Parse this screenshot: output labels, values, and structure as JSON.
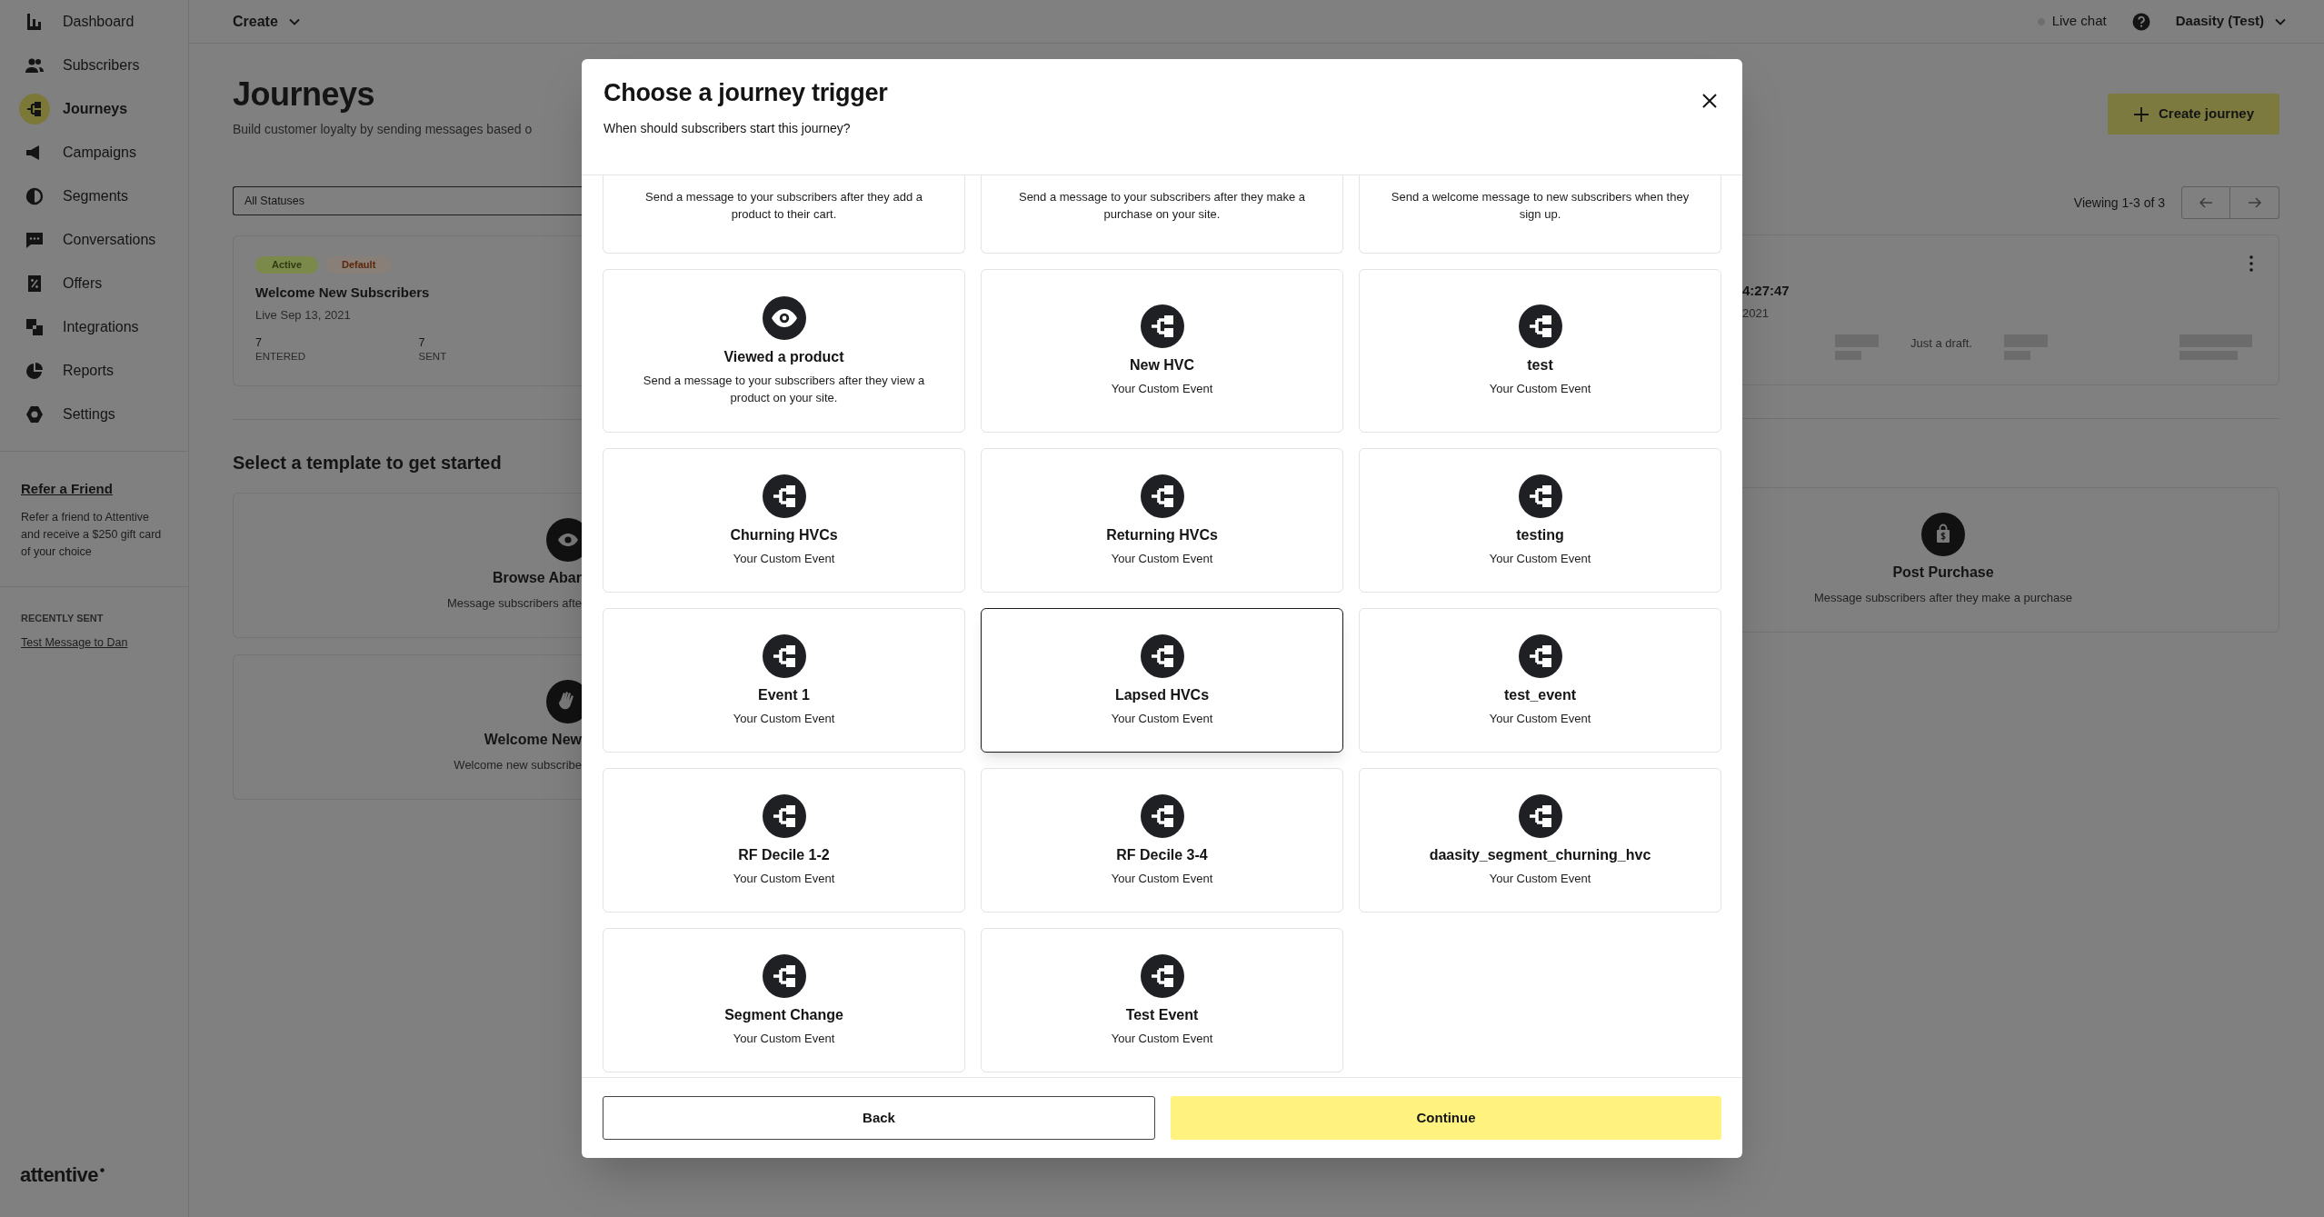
{
  "sidebar": {
    "items": [
      {
        "label": "Dashboard",
        "selected": false
      },
      {
        "label": "Subscribers",
        "selected": false
      },
      {
        "label": "Journeys",
        "selected": true
      },
      {
        "label": "Campaigns",
        "selected": false
      },
      {
        "label": "Segments",
        "selected": false
      },
      {
        "label": "Conversations",
        "selected": false
      },
      {
        "label": "Offers",
        "selected": false
      },
      {
        "label": "Integrations",
        "selected": false
      },
      {
        "label": "Reports",
        "selected": false
      },
      {
        "label": "Settings",
        "selected": false
      }
    ],
    "promo": {
      "title": "Refer a Friend",
      "text": "Refer a friend to Attentive and receive a $250 gift card of your choice"
    },
    "recently_sent": {
      "heading": "RECENTLY SENT",
      "items": [
        "Test Message to Dan"
      ]
    },
    "logo": "attentive"
  },
  "top_bar": {
    "create_menu": "Create",
    "live_chat": "Live chat",
    "account": "Daasity (Test)"
  },
  "page": {
    "title": "Journeys",
    "subtitle": "Build customer loyalty by sending messages based o",
    "create_button": "Create journey",
    "status_filter": "All Statuses",
    "pagination": "Viewing 1-3 of 3",
    "journey_left": {
      "badges": [
        {
          "label": "Active",
          "kind": "status"
        },
        {
          "label": "Default",
          "kind": "default"
        }
      ],
      "name": "Welcome New Subscribers",
      "date": "Live Sep 13, 2021",
      "stats": [
        {
          "value": "7",
          "label": "ENTERED"
        },
        {
          "value": "7",
          "label": "SENT"
        }
      ]
    },
    "journey_right": {
      "name": "4:27:47",
      "date": "2021",
      "note": "Just a draft."
    },
    "templates_heading": "Select a template to get started",
    "templates_left": [
      {
        "kind": "browse",
        "title": "Browse Abar",
        "description": "Message subscribers afte"
      },
      {
        "kind": "welcome",
        "title": "Welcome New",
        "description": "Welcome new subscribe"
      }
    ],
    "templates_right": [
      {
        "kind": "purchase",
        "title": "Post Purchase",
        "description": "Message subscribers after they make a purchase"
      }
    ]
  },
  "modal": {
    "title": "Choose a journey trigger",
    "subtitle": "When should subscribers start this journey?",
    "triggers": [
      {
        "kind": "partial",
        "description": "Send a message to your subscribers after they add a product to their cart.",
        "selected": false
      },
      {
        "kind": "partial",
        "description": "Send a message to your subscribers after they make a purchase on your site.",
        "selected": false
      },
      {
        "kind": "partial",
        "description": "Send a welcome message to new subscribers when they sign up.",
        "selected": false
      },
      {
        "kind": "product_event",
        "title": "Viewed a product",
        "description": "Send a message to your subscribers after they view a product on your site.",
        "selected": false
      },
      {
        "kind": "custom_event",
        "title": "New HVC",
        "description": "Your Custom Event",
        "selected": false
      },
      {
        "kind": "custom_event",
        "title": "test",
        "description": "Your Custom Event",
        "selected": false
      },
      {
        "kind": "custom_event",
        "title": "Churning HVCs",
        "description": "Your Custom Event",
        "selected": false
      },
      {
        "kind": "custom_event",
        "title": "Returning HVCs",
        "description": "Your Custom Event",
        "selected": false
      },
      {
        "kind": "custom_event",
        "title": "testing",
        "description": "Your Custom Event",
        "selected": false
      },
      {
        "kind": "custom_event",
        "title": "Event 1",
        "description": "Your Custom Event",
        "selected": false
      },
      {
        "kind": "custom_event",
        "title": "Lapsed HVCs",
        "description": "Your Custom Event",
        "selected": true
      },
      {
        "kind": "custom_event",
        "title": "test_event",
        "description": "Your Custom Event",
        "selected": false
      },
      {
        "kind": "custom_event",
        "title": "RF Decile 1-2",
        "description": "Your Custom Event",
        "selected": false
      },
      {
        "kind": "custom_event",
        "title": "RF Decile 3-4",
        "description": "Your Custom Event",
        "selected": false
      },
      {
        "kind": "custom_event",
        "title": "daasity_segment_churning_hvc",
        "description": "Your Custom Event",
        "selected": false
      },
      {
        "kind": "custom_event",
        "title": "Segment Change",
        "description": "Your Custom Event",
        "selected": false
      },
      {
        "kind": "custom_event",
        "title": "Test Event",
        "description": "Your Custom Event",
        "selected": false
      }
    ],
    "buttons": {
      "back": "Back",
      "continue": "Continue"
    }
  }
}
